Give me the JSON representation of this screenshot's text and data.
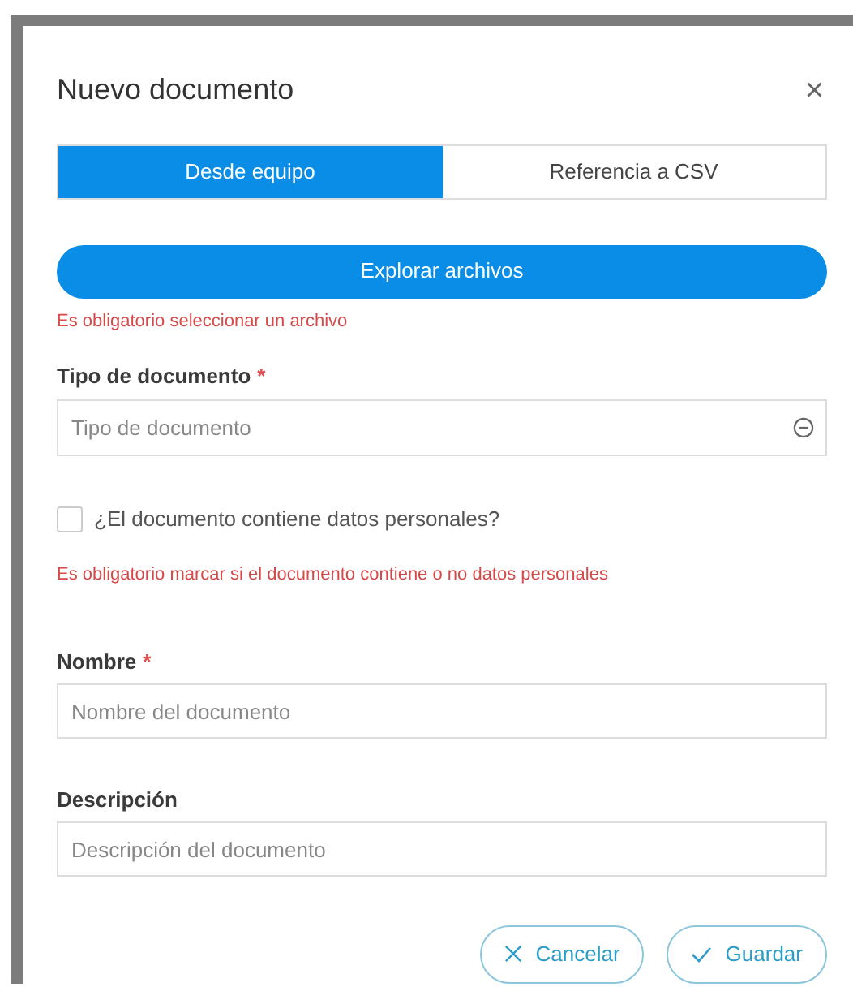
{
  "dialog": {
    "title": "Nuevo documento",
    "close": "×"
  },
  "tabs": [
    {
      "label": "Desde equipo",
      "selected": true
    },
    {
      "label": "Referencia a CSV",
      "selected": false
    }
  ],
  "browse_button": {
    "label": "Explorar archivos"
  },
  "file_error": "Es obligatorio seleccionar un archivo",
  "document_type": {
    "label": "Tipo de documento",
    "required_mark": "*",
    "placeholder": "Tipo de documento"
  },
  "personal_data": {
    "label": "¿El documento contiene datos personales?",
    "checked": false,
    "error": "Es obligatorio marcar si el documento contiene o no datos personales"
  },
  "name": {
    "label": "Nombre",
    "required_mark": "*",
    "placeholder": "Nombre del documento"
  },
  "description": {
    "label": "Descripción",
    "placeholder": "Descripción del documento"
  },
  "buttons": [
    {
      "kind": "cancel",
      "label": "Cancelar"
    },
    {
      "kind": "save",
      "label": "Guardar"
    }
  ]
}
